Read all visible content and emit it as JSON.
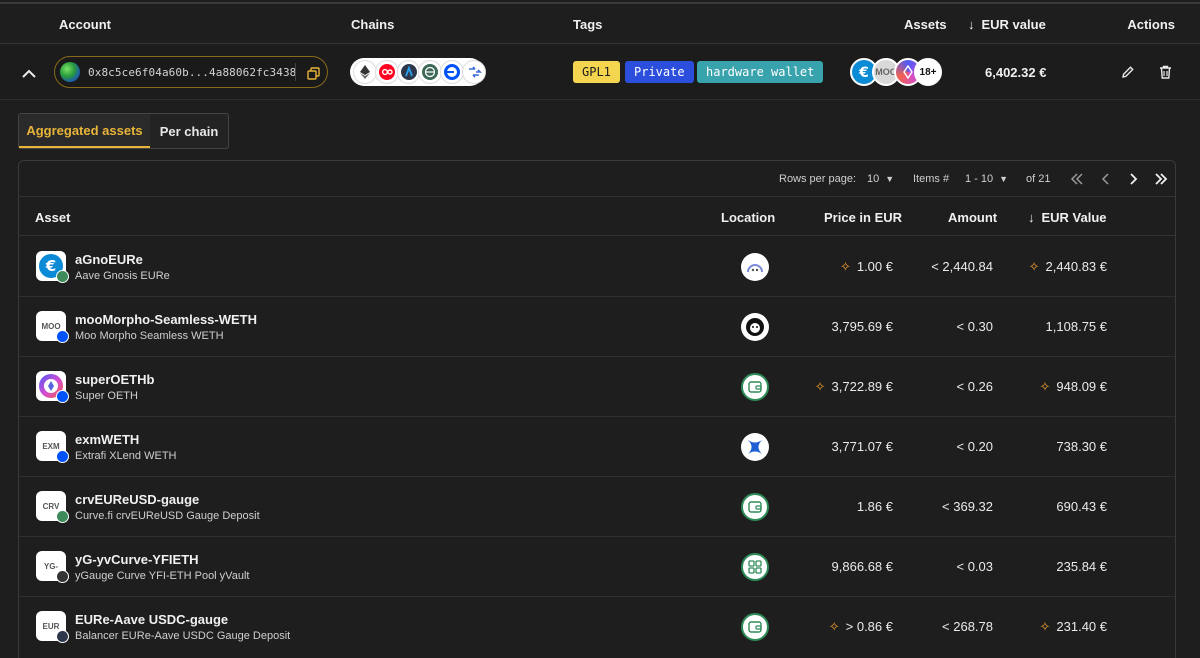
{
  "header": {
    "account": "Account",
    "chains": "Chains",
    "tags": "Tags",
    "assets": "Assets",
    "eur_value": "EUR value",
    "actions": "Actions"
  },
  "account": {
    "address": "0x8c5ce6f04a60b...4a88062fc3438",
    "chain_icons": [
      "ethereum-icon",
      "optimism-icon",
      "arbitrum-icon",
      "gnosis-icon",
      "base-icon",
      "bridge-icon"
    ],
    "tags": [
      "GPL1",
      "Private",
      "hardware wallet"
    ],
    "asset_icons": [
      "eure-icon",
      "moo-icon",
      "superoeth-icon"
    ],
    "asset_stack_icon_label": "MOO",
    "more_assets": "18+",
    "eur_value": "6,402.32 €"
  },
  "tabs": {
    "aggregated": "Aggregated assets",
    "per_chain": "Per chain"
  },
  "pager": {
    "rows_label": "Rows per page:",
    "rows_value": "10",
    "items_label": "Items #",
    "items_value": "1 - 10",
    "of_total": "of 21"
  },
  "table": {
    "headers": {
      "asset": "Asset",
      "location": "Location",
      "price": "Price in EUR",
      "amount": "Amount",
      "value": "EUR Value"
    },
    "rows": [
      {
        "icon_text": "",
        "symbol": "aGnoEURe",
        "name": "Aave Gnosis EURe",
        "price": "1.00 €",
        "price_spark": true,
        "amount": "< 2,440.84",
        "value": "2,440.83 €",
        "value_spark": true,
        "location_icon": "aave-icon"
      },
      {
        "icon_text": "MOO",
        "symbol": "mooMorpho-Seamless-WETH",
        "name": "Moo Morpho Seamless WETH",
        "price": "3,795.69 €",
        "price_spark": false,
        "amount": "< 0.30",
        "value": "1,108.75 €",
        "value_spark": false,
        "location_icon": "beefy-icon"
      },
      {
        "icon_text": "",
        "symbol": "superOETHb",
        "name": "Super OETH",
        "price": "3,722.89 €",
        "price_spark": true,
        "amount": "< 0.26",
        "value": "948.09 €",
        "value_spark": true,
        "location_icon": "wallet-icon"
      },
      {
        "icon_text": "EXM",
        "symbol": "exmWETH",
        "name": "Extrafi XLend WETH",
        "price": "3,771.07 €",
        "price_spark": false,
        "amount": "< 0.20",
        "value": "738.30 €",
        "value_spark": false,
        "location_icon": "extrafi-icon"
      },
      {
        "icon_text": "CRV",
        "symbol": "crvEUReUSD-gauge",
        "name": "Curve.fi crvEUReUSD Gauge Deposit",
        "price": "1.86 €",
        "price_spark": false,
        "amount": "< 369.32",
        "value": "690.43 €",
        "value_spark": false,
        "location_icon": "wallet-icon"
      },
      {
        "icon_text": "YG-",
        "symbol": "yG-yvCurve-YFIETH",
        "name": "yGauge Curve YFI-ETH Pool yVault",
        "price": "9,866.68 €",
        "price_spark": false,
        "amount": "< 0.03",
        "value": "235.84 €",
        "value_spark": false,
        "location_icon": "apps-icon"
      },
      {
        "icon_text": "EUR",
        "symbol": "EURe-Aave USDC-gauge",
        "name": "Balancer EURe-Aave USDC Gauge Deposit",
        "price": "> 0.86 €",
        "price_spark": true,
        "amount": "< 268.78",
        "value": "231.40 €",
        "value_spark": true,
        "location_icon": "wallet-icon"
      }
    ]
  }
}
